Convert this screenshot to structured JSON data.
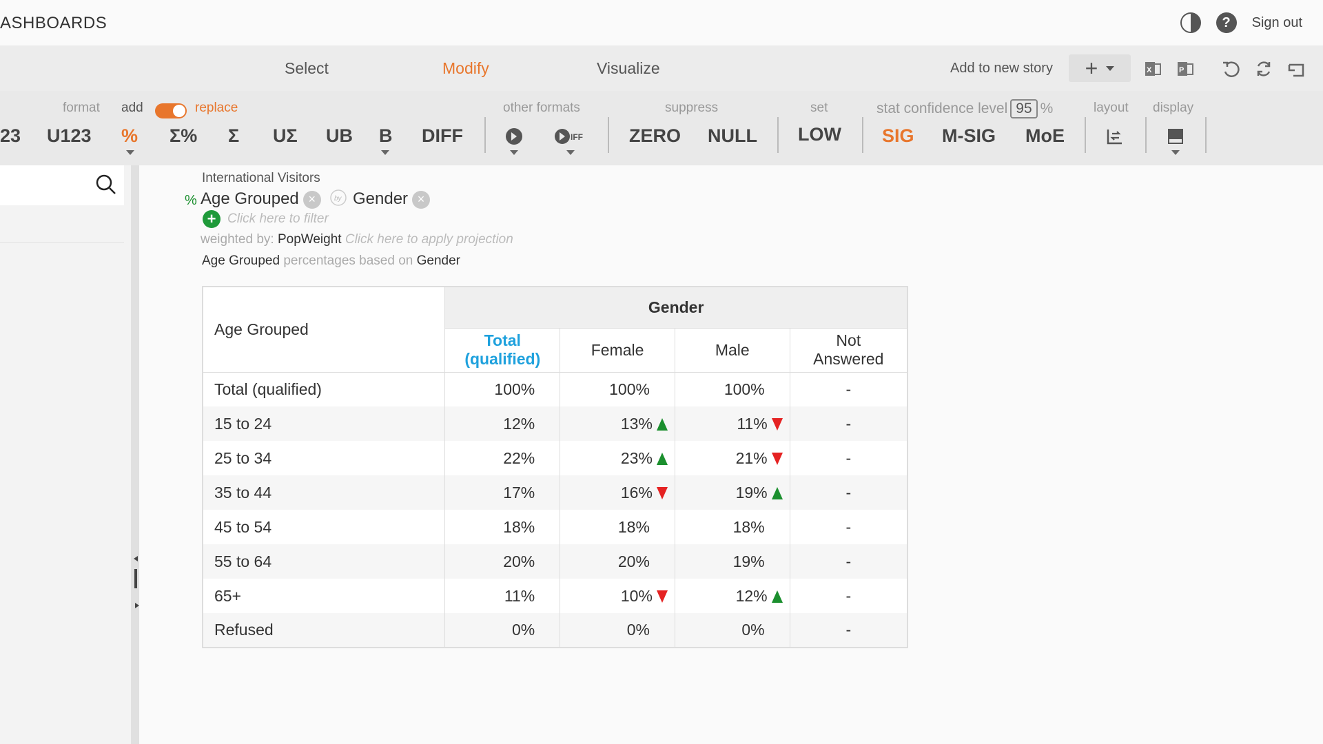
{
  "header": {
    "brand": "ASHBOARDS",
    "sign_out": "Sign out",
    "icons": [
      "contrast-icon",
      "help-icon"
    ]
  },
  "tabs": {
    "items": [
      {
        "label": "Select",
        "active": false
      },
      {
        "label": "Modify",
        "active": true
      },
      {
        "label": "Visualize",
        "active": false
      }
    ],
    "add_story": "Add to new story",
    "add_icon": "plus-icon",
    "tool_icons": [
      "excel-export-icon",
      "powerpoint-export-icon",
      "undo-icon",
      "refresh-icon",
      "restore-icon"
    ]
  },
  "toolbar": {
    "format_label": "format",
    "add_label": "add",
    "replace_label": "replace",
    "other_formats_label": "other formats",
    "suppress_label": "suppress",
    "set_label": "set",
    "stat_label": "stat confidence level",
    "confidence": "95",
    "percent_sign": "%",
    "layout_label": "layout",
    "display_label": "display",
    "buttons": {
      "b123": "23",
      "u123": "U123",
      "pct": "%",
      "sum_pct": "Σ%",
      "sum": "Σ",
      "u_sum": "UΣ",
      "ub": "UB",
      "b": "B",
      "diff": "DIFF",
      "zero": "ZERO",
      "null": "NULL",
      "low": "LOW",
      "sig": "SIG",
      "msig": "M-SIG",
      "moe": "MoE"
    }
  },
  "filter": {
    "dataset": "International Visitors",
    "pct_sign": "%",
    "row_var": "Age Grouped",
    "col_var": "Gender",
    "filter_hint": "Click here to filter",
    "weighted_label": "weighted by:",
    "weight_var": "PopWeight",
    "projection_hint": "Click here to apply projection",
    "base_row": "Age Grouped",
    "base_text": "percentages based on",
    "base_col": "Gender"
  },
  "table": {
    "row_header": "Age Grouped",
    "group_header": "Gender",
    "columns": [
      "Total (qualified)",
      "Female",
      "Male",
      "Not Answered"
    ],
    "rows": [
      {
        "label": "Total (qualified)",
        "cells": [
          {
            "v": "100%",
            "s": ""
          },
          {
            "v": "100%",
            "s": ""
          },
          {
            "v": "100%",
            "s": ""
          },
          {
            "v": "-",
            "s": ""
          }
        ]
      },
      {
        "label": "15 to 24",
        "cells": [
          {
            "v": "12%",
            "s": ""
          },
          {
            "v": "13%",
            "s": "up"
          },
          {
            "v": "11%",
            "s": "down"
          },
          {
            "v": "-",
            "s": ""
          }
        ]
      },
      {
        "label": "25 to 34",
        "cells": [
          {
            "v": "22%",
            "s": ""
          },
          {
            "v": "23%",
            "s": "up"
          },
          {
            "v": "21%",
            "s": "down"
          },
          {
            "v": "-",
            "s": ""
          }
        ]
      },
      {
        "label": "35 to 44",
        "cells": [
          {
            "v": "17%",
            "s": ""
          },
          {
            "v": "16%",
            "s": "down"
          },
          {
            "v": "19%",
            "s": "up"
          },
          {
            "v": "-",
            "s": ""
          }
        ]
      },
      {
        "label": "45 to 54",
        "cells": [
          {
            "v": "18%",
            "s": ""
          },
          {
            "v": "18%",
            "s": ""
          },
          {
            "v": "18%",
            "s": ""
          },
          {
            "v": "-",
            "s": ""
          }
        ]
      },
      {
        "label": "55 to 64",
        "cells": [
          {
            "v": "20%",
            "s": ""
          },
          {
            "v": "20%",
            "s": ""
          },
          {
            "v": "19%",
            "s": ""
          },
          {
            "v": "-",
            "s": ""
          }
        ]
      },
      {
        "label": "65+",
        "cells": [
          {
            "v": "11%",
            "s": ""
          },
          {
            "v": "10%",
            "s": "down"
          },
          {
            "v": "12%",
            "s": "up"
          },
          {
            "v": "-",
            "s": ""
          }
        ]
      },
      {
        "label": "Refused",
        "cells": [
          {
            "v": "0%",
            "s": ""
          },
          {
            "v": "0%",
            "s": ""
          },
          {
            "v": "0%",
            "s": ""
          },
          {
            "v": "-",
            "s": ""
          }
        ]
      }
    ]
  },
  "colors": {
    "accent": "#e8762c",
    "total_col": "#1ea1dd",
    "sig_up": "#1b8f2e",
    "sig_down": "#e52222"
  }
}
